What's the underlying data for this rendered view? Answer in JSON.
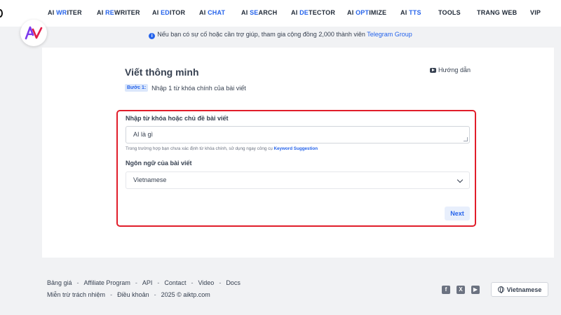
{
  "nav": {
    "items": [
      {
        "pre": "AI ",
        "hl": "WR",
        "post": "ITER"
      },
      {
        "pre": "AI ",
        "hl": "RE",
        "post": "WRITER"
      },
      {
        "pre": "AI ",
        "hl": "ED",
        "post": "ITOR"
      },
      {
        "pre": "AI ",
        "hl": "CHAT",
        "post": ""
      },
      {
        "pre": "AI ",
        "hl": "SE",
        "post": "ARCH"
      },
      {
        "pre": "AI ",
        "hl": "DE",
        "post": "TECTOR"
      },
      {
        "pre": "AI ",
        "hl": "OPT",
        "post": "IMIZE"
      },
      {
        "pre": "AI ",
        "hl": "TTS",
        "post": ""
      },
      {
        "pre": "TOOLS",
        "hl": "",
        "post": ""
      },
      {
        "pre": "TRANG WEB",
        "hl": "",
        "post": ""
      },
      {
        "pre": "VIP",
        "hl": "",
        "post": ""
      }
    ]
  },
  "notice": {
    "text": "Nếu bạn có sự cố hoặc cần trợ giúp, tham gia cộng đồng 2,000 thành viên ",
    "link": "Telegram Group"
  },
  "page": {
    "title": "Viết thông minh",
    "help_label": "Hướng dẫn",
    "step_badge": "Bước 1:",
    "step_text": "Nhập 1 từ khóa chính của bài viết"
  },
  "form": {
    "keyword_label": "Nhập từ khóa hoặc chủ đề bài viết",
    "keyword_value": "AI là gì",
    "hint_text": "Trong trường hợp bạn chưa xác định từ khóa chính, sử dụng ngay công cụ ",
    "hint_link": "Keyword Suggestion",
    "language_label": "Ngôn ngữ của bài viết",
    "language_value": "Vietnamese",
    "next_label": "Next"
  },
  "footer": {
    "row1": [
      "Bảng giá",
      "Affiliate Program",
      "API",
      "Contact",
      "Video",
      "Docs"
    ],
    "row2": [
      "Miễn trừ trách nhiệm",
      "Điều khoản",
      "2025 © aiktp.com"
    ],
    "language_button": "Vietnamese"
  },
  "colors": {
    "accent": "#2563eb",
    "highlight_border": "#e11d2a",
    "logo_purple": "#7c3aed",
    "logo_red": "#e11d48"
  },
  "icons": {
    "notice": "info-icon",
    "help": "youtube-icon",
    "select": "chevron-down-icon",
    "socials": [
      "facebook-icon",
      "x-twitter-icon",
      "youtube-icon"
    ],
    "language": "globe-icon"
  }
}
